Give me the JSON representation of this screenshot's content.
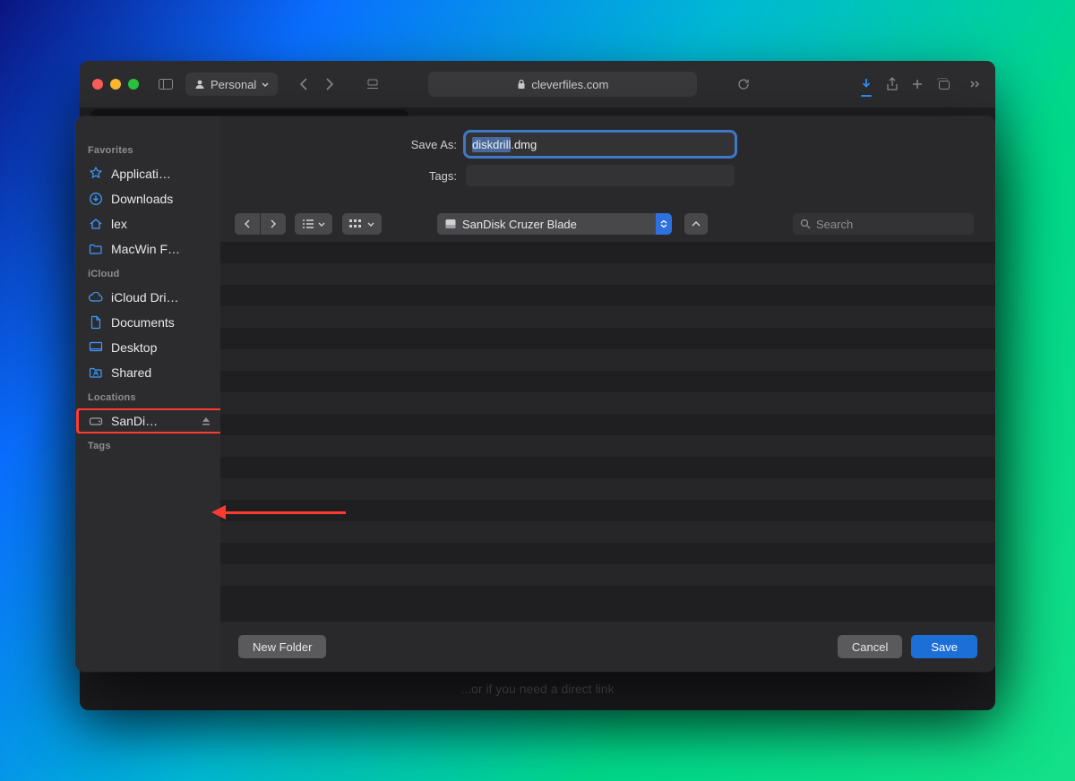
{
  "safari": {
    "profile_label": "Personal",
    "url_host": "cleverfiles.com",
    "bottom_hint": "...or if you need a direct link"
  },
  "dialog": {
    "save_as_label": "Save As:",
    "tags_label": "Tags:",
    "filename_base": "diskdrill",
    "filename_ext": ".dmg",
    "location_selected": "SanDisk Cruzer Blade",
    "search_placeholder": "Search",
    "new_folder_label": "New Folder",
    "cancel_label": "Cancel",
    "save_label": "Save"
  },
  "sidebar": {
    "sections": {
      "favorites": {
        "title": "Favorites",
        "items": [
          "Applicati…",
          "Downloads",
          "lex",
          "MacWin F…"
        ]
      },
      "icloud": {
        "title": "iCloud",
        "items": [
          "iCloud Dri…",
          "Documents",
          "Desktop",
          "Shared"
        ]
      },
      "locations": {
        "title": "Locations",
        "items": [
          "SanDi…"
        ]
      },
      "tags": {
        "title": "Tags"
      }
    }
  }
}
